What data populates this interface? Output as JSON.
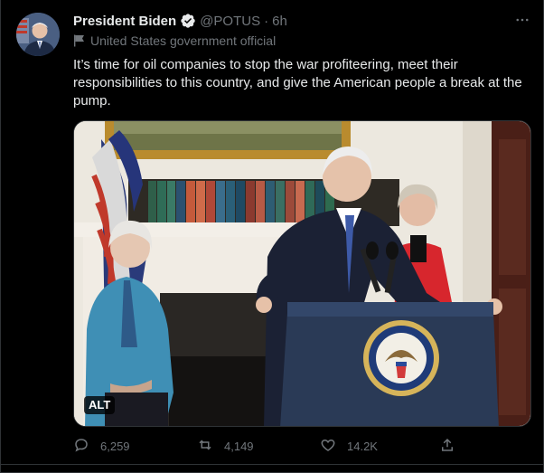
{
  "tweet": {
    "author_name": "President Biden",
    "handle": "@POTUS",
    "separator": "·",
    "time": "6h",
    "account_label": "United States government official",
    "text": "It’s time for oil companies to stop the war profiteering, meet their responsibilities to this country, and give the American people a break at the pump.",
    "alt_badge": "ALT",
    "more_icon": "more-dots-icon",
    "verified_icon": "verified-badge-icon",
    "label_icon": "government-flag-icon"
  },
  "actions": {
    "reply_count": "6,259",
    "retweet_count": "4,149",
    "like_count": "14.2K",
    "reply_icon": "reply-icon",
    "retweet_icon": "retweet-icon",
    "like_icon": "heart-icon",
    "share_icon": "share-icon"
  },
  "colors": {
    "background": "#000000",
    "text_primary": "#e7e9ea",
    "text_secondary": "#71767b",
    "border": "#2f3336"
  }
}
